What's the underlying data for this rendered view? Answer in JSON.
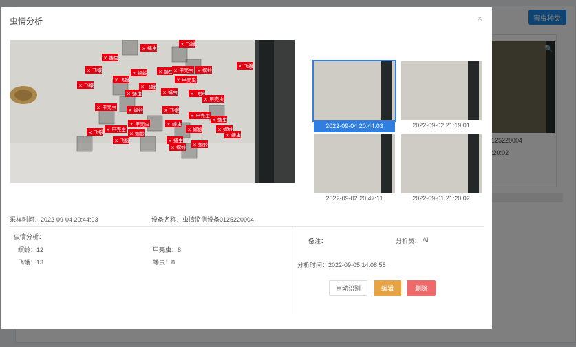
{
  "background": {
    "button_label": "害虫种类",
    "text_device_id": "125220004",
    "text_time": ":20:02"
  },
  "modal": {
    "title": "虫情分析",
    "close_symbol": "×",
    "thumbnails": [
      {
        "caption": "2022-09-04 20:44:03",
        "active": true
      },
      {
        "caption": "2022-09-02 21:19:01",
        "active": false
      },
      {
        "caption": "2022-09-02 20:47:11",
        "active": false
      },
      {
        "caption": "2022-09-01 21:20:02",
        "active": false
      }
    ],
    "sample_time": "采样时间：2022-09-04 20:44:03",
    "device_name": "设备名称：虫情监测设备0125220004",
    "analysis_heading": "虫情分析：",
    "counts": {
      "mite": "螟蛉：12",
      "beetle": "甲壳虫：8",
      "moth": "飞蛾：13",
      "aphid": "蝽虫：8"
    },
    "remarks_label": "备注：",
    "analyst_label": "分析员：",
    "analyst_value": "AI",
    "analysis_time": "分析时间：2022-09-05 14:08:58",
    "buttons": {
      "auto": "自动识别",
      "edit": "编辑",
      "delete": "删除"
    },
    "tag_prefix": "×",
    "tag_labels": [
      "蝽虫",
      "螟蛉",
      "飞蛾",
      "甲壳虫"
    ],
    "tag_color": "#e60012"
  }
}
